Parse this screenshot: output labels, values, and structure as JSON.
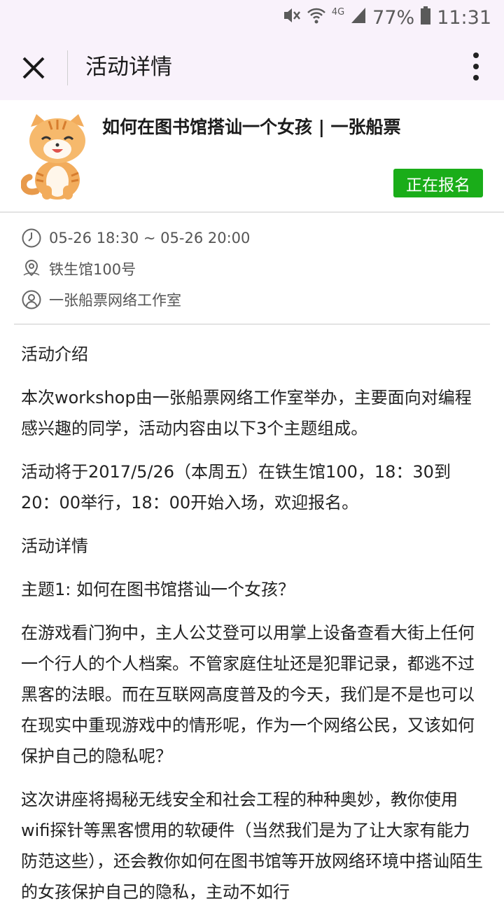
{
  "status_bar": {
    "network": "4G",
    "battery": "77%",
    "time": "11:31"
  },
  "nav": {
    "title": "活动详情"
  },
  "event": {
    "title": "如何在图书馆搭讪一个女孩 | 一张船票",
    "status_label": "正在报名",
    "status_color": "#1aad19"
  },
  "info": {
    "time": "05-26 18:30 ~ 05-26 20:00",
    "location": "铁生馆100号",
    "organizer": "一张船票网络工作室"
  },
  "content": {
    "intro_heading": "活动介绍",
    "intro_p1": "本次workshop由一张船票网络工作室举办，主要面向对编程感兴趣的同学，活动内容由以下3个主题组成。",
    "intro_p2": "活动将于2017/5/26（本周五）在铁生馆100，18：30到20：00举行，18：00开始入场，欢迎报名。",
    "details_heading": "活动详情",
    "topic1_heading": "主题1: 如何在图书馆搭讪一个女孩？",
    "topic1_p1": "在游戏看门狗中，主人公艾登可以用掌上设备查看大街上任何一个行人的个人档案。不管家庭住址还是犯罪记录，都逃不过黑客的法眼。而在互联网高度普及的今天，我们是不是也可以在现实中重现游戏中的情形呢，作为一个网络公民，又该如何保护自己的隐私呢？",
    "topic1_p2": "这次讲座将揭秘无线安全和社会工程的种种奥妙，教你使用wifi探针等黑客惯用的软硬件（当然我们是为了让大家有能力防范这些），还会教你如何在图书馆等开放网络环境中搭讪陌生的女孩保护自己的隐私，主动不如行"
  }
}
